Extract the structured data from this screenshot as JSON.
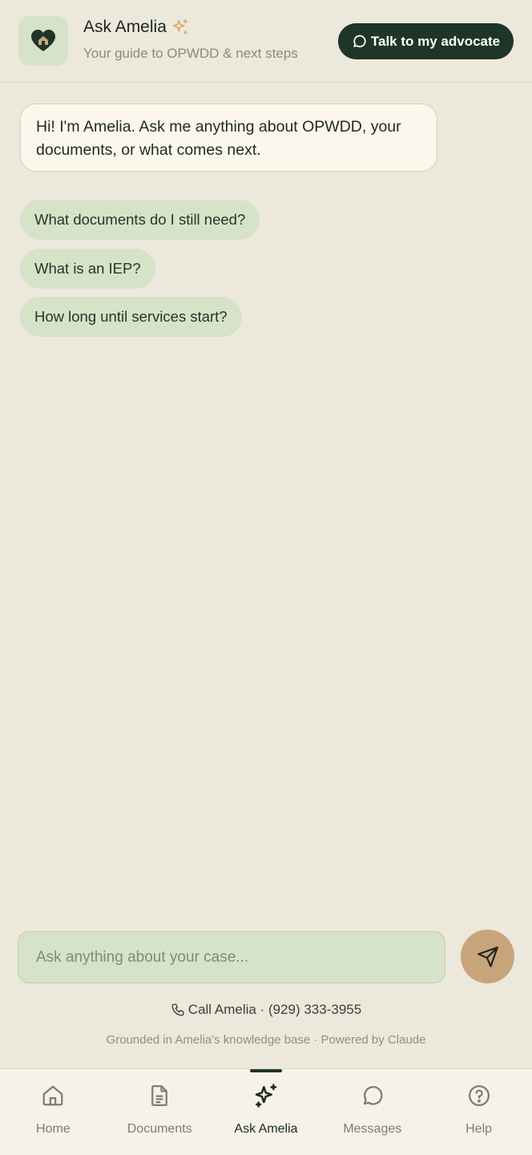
{
  "header": {
    "title": "Ask Amelia",
    "subtitle": "Your guide to OPWDD & next steps",
    "advocate_button": "Talk to my advocate"
  },
  "chat": {
    "greeting": "Hi! I'm Amelia. Ask me anything about OPWDD, your documents, or what comes next.",
    "suggestions": [
      "What documents do I still need?",
      "What is an IEP?",
      "How long until services start?"
    ]
  },
  "composer": {
    "placeholder": "Ask anything about your case..."
  },
  "footer": {
    "call_text": "Call Amelia · (929) 333-3955",
    "grounded_text": "Grounded in Amelia's knowledge base · Powered by Claude"
  },
  "nav": {
    "items": [
      {
        "label": "Home",
        "icon": "home-icon"
      },
      {
        "label": "Documents",
        "icon": "document-icon"
      },
      {
        "label": "Ask Amelia",
        "icon": "sparkle-icon"
      },
      {
        "label": "Messages",
        "icon": "chat-bubble-icon"
      },
      {
        "label": "Help",
        "icon": "help-icon"
      }
    ],
    "active": "Ask Amelia"
  },
  "colors": {
    "background": "#EDE8DC",
    "primary_dark": "#1E3527",
    "sage": "#D6E3C8",
    "accent_tan": "#C8A47A",
    "sparkle": "#D9A86A"
  }
}
